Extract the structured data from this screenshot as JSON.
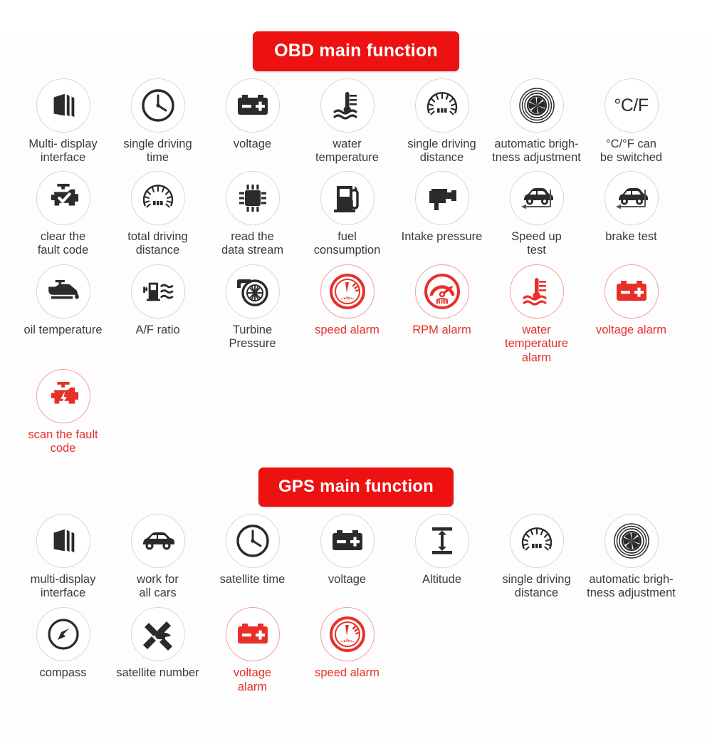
{
  "sections": [
    {
      "id": "obd",
      "badge_label": "OBD main function",
      "rows": [
        [
          {
            "icon": "multi-display-panels-icon",
            "label": "Multi- display\ninterface",
            "color": "black"
          },
          {
            "icon": "clock-icon",
            "label": "single driving\ntime",
            "color": "black"
          },
          {
            "icon": "battery-icon",
            "label": "voltage",
            "color": "black"
          },
          {
            "icon": "water-thermometer-icon",
            "label": "water\ntemperature",
            "color": "black"
          },
          {
            "icon": "odometer-gauge-icon",
            "label": "single driving\ndistance",
            "color": "black"
          },
          {
            "icon": "aperture-brightness-icon",
            "label": "automatic brigh-\ntness adjustment",
            "color": "black"
          },
          {
            "icon": "celsius-fahrenheit-icon",
            "label": "°C/°F can\nbe switched",
            "color": "black",
            "glyph": "°C/F"
          }
        ],
        [
          {
            "icon": "engine-check-ok-icon",
            "label": "clear the\nfault code",
            "color": "black"
          },
          {
            "icon": "odometer-gauge-icon",
            "label": "total driving\ndistance",
            "color": "black"
          },
          {
            "icon": "cpu-chip-icon",
            "label": "read the\ndata stream",
            "color": "black"
          },
          {
            "icon": "fuel-pump-icon",
            "label": "fuel\nconsumption",
            "color": "black"
          },
          {
            "icon": "intake-manifold-icon",
            "label": "Intake pressure",
            "color": "black"
          },
          {
            "icon": "car-accelerate-icon",
            "label": "Speed up\ntest",
            "color": "black"
          },
          {
            "icon": "car-brake-icon",
            "label": "brake test",
            "color": "black"
          }
        ],
        [
          {
            "icon": "oil-can-icon",
            "label": "oil temperature",
            "color": "black"
          },
          {
            "icon": "fuel-air-waves-icon",
            "label": "A/F ratio",
            "color": "black"
          },
          {
            "icon": "turbocharger-icon",
            "label": "Turbine\nPressure",
            "color": "black"
          },
          {
            "icon": "speedometer-alarm-icon",
            "label": "speed alarm",
            "color": "red",
            "glyph": "KM/H"
          },
          {
            "icon": "rpm-gauge-alarm-icon",
            "label": "RPM alarm",
            "color": "red"
          },
          {
            "icon": "water-thermometer-alarm-icon",
            "label": "water temperature\nalarm",
            "color": "red"
          },
          {
            "icon": "battery-alarm-icon",
            "label": "voltage alarm",
            "color": "red"
          }
        ],
        [
          {
            "icon": "engine-fault-scan-icon",
            "label": "scan the fault code",
            "color": "red"
          }
        ]
      ]
    },
    {
      "id": "gps",
      "badge_label": "GPS main function",
      "rows": [
        [
          {
            "icon": "multi-display-panels-icon",
            "label": "multi-display\ninterface",
            "color": "black"
          },
          {
            "icon": "car-side-icon",
            "label": "work for\nall cars",
            "color": "black"
          },
          {
            "icon": "clock-icon",
            "label": "satellite time",
            "color": "black"
          },
          {
            "icon": "battery-icon",
            "label": "voltage",
            "color": "black"
          },
          {
            "icon": "altitude-arrow-icon",
            "label": "Altitude",
            "color": "black"
          },
          {
            "icon": "odometer-gauge-icon",
            "label": "single driving\ndistance",
            "color": "black"
          },
          {
            "icon": "aperture-brightness-icon",
            "label": "automatic brigh-\ntness adjustment",
            "color": "black"
          }
        ],
        [
          {
            "icon": "compass-icon",
            "label": "compass",
            "color": "black"
          },
          {
            "icon": "satellite-icon",
            "label": "satellite number",
            "color": "black"
          },
          {
            "icon": "battery-alarm-icon",
            "label": "voltage\nalarm",
            "color": "red"
          },
          {
            "icon": "speedometer-alarm-icon",
            "label": "speed alarm",
            "color": "red",
            "glyph": "KM/H"
          }
        ]
      ]
    }
  ],
  "colors": {
    "badge_red": "#ee1111",
    "alarm_red": "#e8302a",
    "icon_black": "#2b2b2b",
    "ring_grey": "#d8d8d8",
    "background": "#fdfdfd"
  }
}
